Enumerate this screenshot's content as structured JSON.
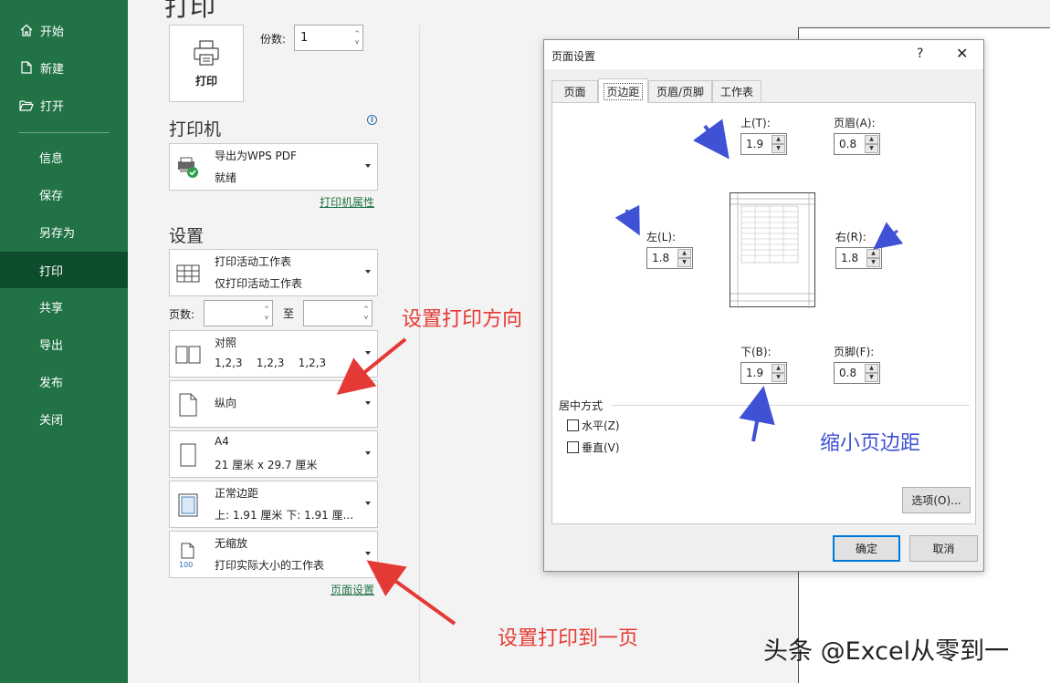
{
  "sidebar": {
    "items": [
      {
        "label": "开始",
        "icon": "home-icon"
      },
      {
        "label": "新建",
        "icon": "new-doc-icon"
      },
      {
        "label": "打开",
        "icon": "open-folder-icon"
      },
      {
        "label": "信息"
      },
      {
        "label": "保存"
      },
      {
        "label": "另存为"
      },
      {
        "label": "打印",
        "active": true
      },
      {
        "label": "共享"
      },
      {
        "label": "导出"
      },
      {
        "label": "发布"
      },
      {
        "label": "关闭"
      }
    ],
    "accent": "#217346",
    "active_bg": "#0e4d2b"
  },
  "print_panel": {
    "title": "打印",
    "print_button": "打印",
    "copies_label": "份数:",
    "copies_value": "1",
    "printer_heading": "打印机",
    "printer": {
      "name": "导出为WPS PDF",
      "status": "就绪"
    },
    "printer_properties": "打印机属性",
    "settings_heading": "设置",
    "options": {
      "scope": {
        "line1": "打印活动工作表",
        "line2": "仅打印活动工作表"
      },
      "pages_label": "页数:",
      "to_label": "至",
      "collate": {
        "line1": "对照",
        "line2": "1,2,3    1,2,3    1,2,3"
      },
      "orientation": {
        "line1": "纵向"
      },
      "paper": {
        "line1": "A4",
        "line2": "21 厘米 x 29.7 厘米"
      },
      "margins": {
        "line1": "正常边距",
        "line2": "上: 1.91 厘米 下: 1.91 厘..."
      },
      "scaling": {
        "line1": "无缩放",
        "line2": "打印实际大小的工作表",
        "icon_text": "100"
      }
    },
    "page_setup_link": "页面设置"
  },
  "annotations": {
    "orientation": "设置打印方向",
    "fit_one_page": "设置打印到一页",
    "shrink_margins": "缩小页边距",
    "red": "#e53935",
    "blue": "#3f51d4"
  },
  "watermark": "头条 @Excel从零到一",
  "dialog": {
    "title": "页面设置",
    "help": "?",
    "close": "✕",
    "tabs": [
      "页面",
      "页边距",
      "页眉/页脚",
      "工作表"
    ],
    "active_tab": "页边距",
    "fields": {
      "top": {
        "label": "上(T):",
        "value": "1.9"
      },
      "header": {
        "label": "页眉(A):",
        "value": "0.8"
      },
      "left": {
        "label": "左(L):",
        "value": "1.8"
      },
      "right": {
        "label": "右(R):",
        "value": "1.8"
      },
      "bottom": {
        "label": "下(B):",
        "value": "1.9"
      },
      "footer": {
        "label": "页脚(F):",
        "value": "0.8"
      }
    },
    "center_group": "居中方式",
    "horizontal": "水平(Z)",
    "vertical": "垂直(V)",
    "options_button": "选项(O)...",
    "ok": "确定",
    "cancel": "取消"
  }
}
